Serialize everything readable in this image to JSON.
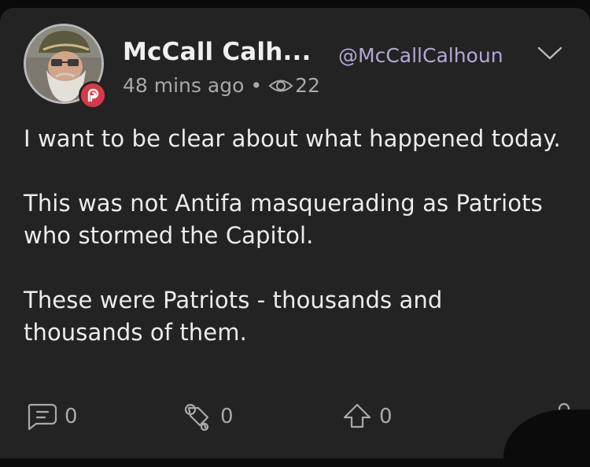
{
  "post": {
    "author_name": "McCall Calh...",
    "author_handle": "@McCallCalhoun",
    "time_ago": "48 mins ago",
    "separator": "•",
    "view_count": "22",
    "paragraphs": [
      "I want to be clear about what happened today.",
      "This was not Antifa masquerading as Patriots who stormed the Capitol.",
      "These were Patriots - thousands and thousands of them."
    ]
  },
  "actions": {
    "comments": "0",
    "echoes": "0",
    "upvotes": "0"
  },
  "icons": {
    "badge": "parler-logo-icon",
    "views": "eye-icon",
    "comment": "comment-icon",
    "echo": "echo-icon",
    "upvote": "upvote-icon",
    "share": "share-icon",
    "menu": "chevron-down-icon"
  },
  "colors": {
    "card_background": "#232323",
    "handle": "#b4a7d6",
    "badge": "#d43a47",
    "muted_text": "#a9a9a9"
  }
}
